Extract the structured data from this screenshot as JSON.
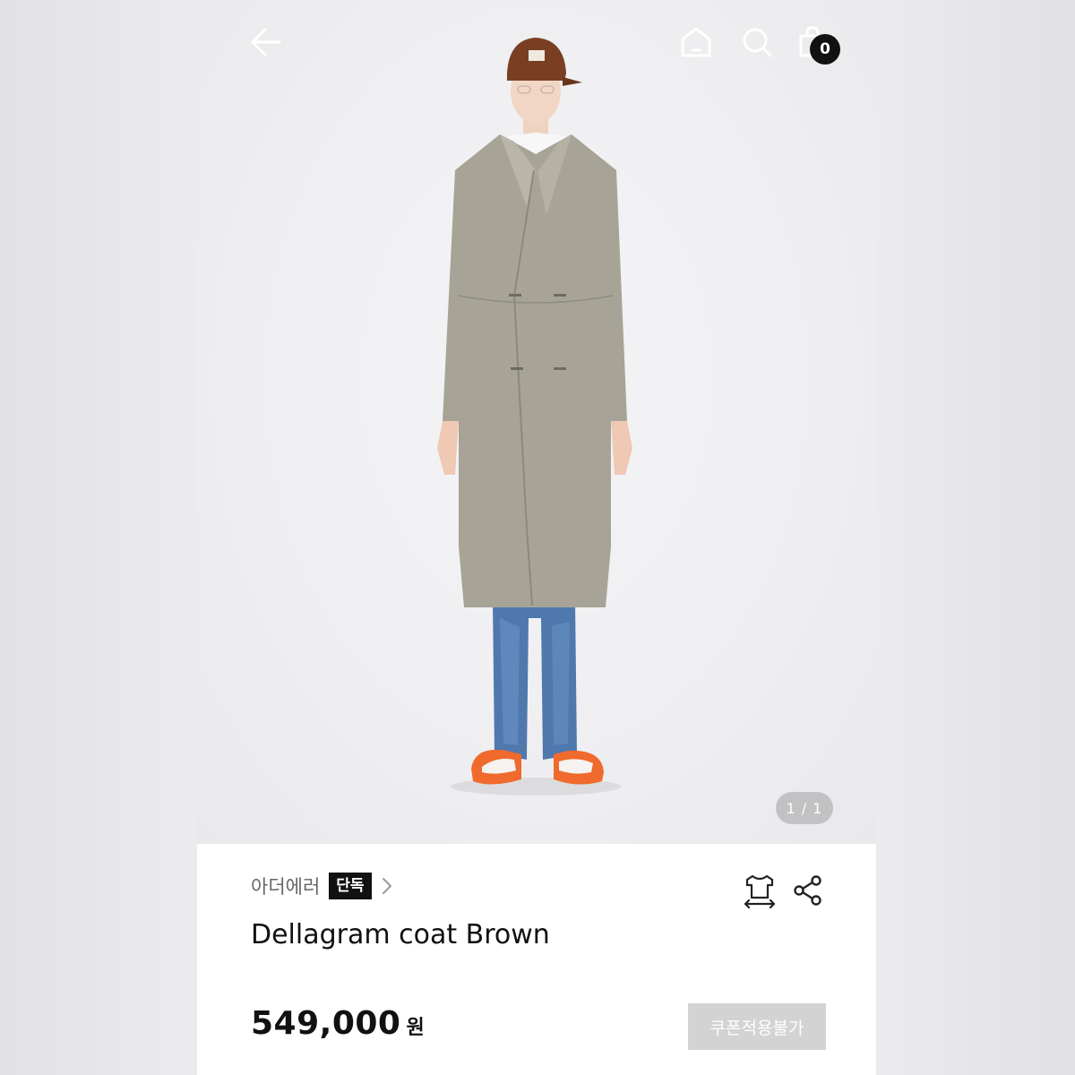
{
  "header": {
    "back_icon": "arrow-left-icon",
    "home_icon": "home-icon",
    "search_icon": "search-icon",
    "cart_icon": "shopping-bag-icon",
    "cart_count": "0"
  },
  "gallery": {
    "counter": "1 / 1"
  },
  "product": {
    "brand": "아더에러",
    "exclusive_label": "단독",
    "name": "Dellagram coat Brown",
    "price": "549,000",
    "price_unit": "원",
    "coupon_label": "쿠폰적용불가",
    "size_icon": "size-guide-icon",
    "share_icon": "share-icon"
  },
  "colors": {
    "badge": "#111111",
    "coupon_disabled": "#d3d3d3",
    "counter_pill": "#c2c2c4"
  }
}
